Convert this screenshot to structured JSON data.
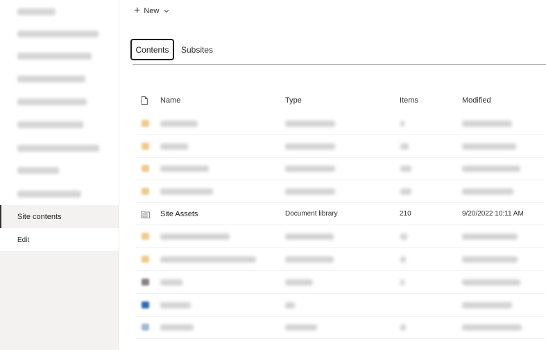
{
  "sidebar": {
    "selected_label": "Site contents",
    "edit_label": "Edit"
  },
  "command_bar": {
    "new_label": "New"
  },
  "tabs": [
    {
      "label": "Contents",
      "active": true
    },
    {
      "label": "Subsites",
      "active": false
    }
  ],
  "table": {
    "columns": [
      "Name",
      "Type",
      "Items",
      "Modified"
    ],
    "visible_row": {
      "name": "Site Assets",
      "type": "Document library",
      "items": "210",
      "modified": "9/20/2022 10:11 AM"
    }
  },
  "colors": {
    "folder_icon": "#f2c98a",
    "list_icon_gray": "#8a7f7f",
    "page_icon_blue": "#2b6cb0",
    "selected_nav_bg": "#f3f2f1"
  },
  "icons": {
    "new": "plus-icon",
    "new_menu": "chevron-down-icon",
    "header_file": "file-icon",
    "site_assets": "library-icon"
  }
}
